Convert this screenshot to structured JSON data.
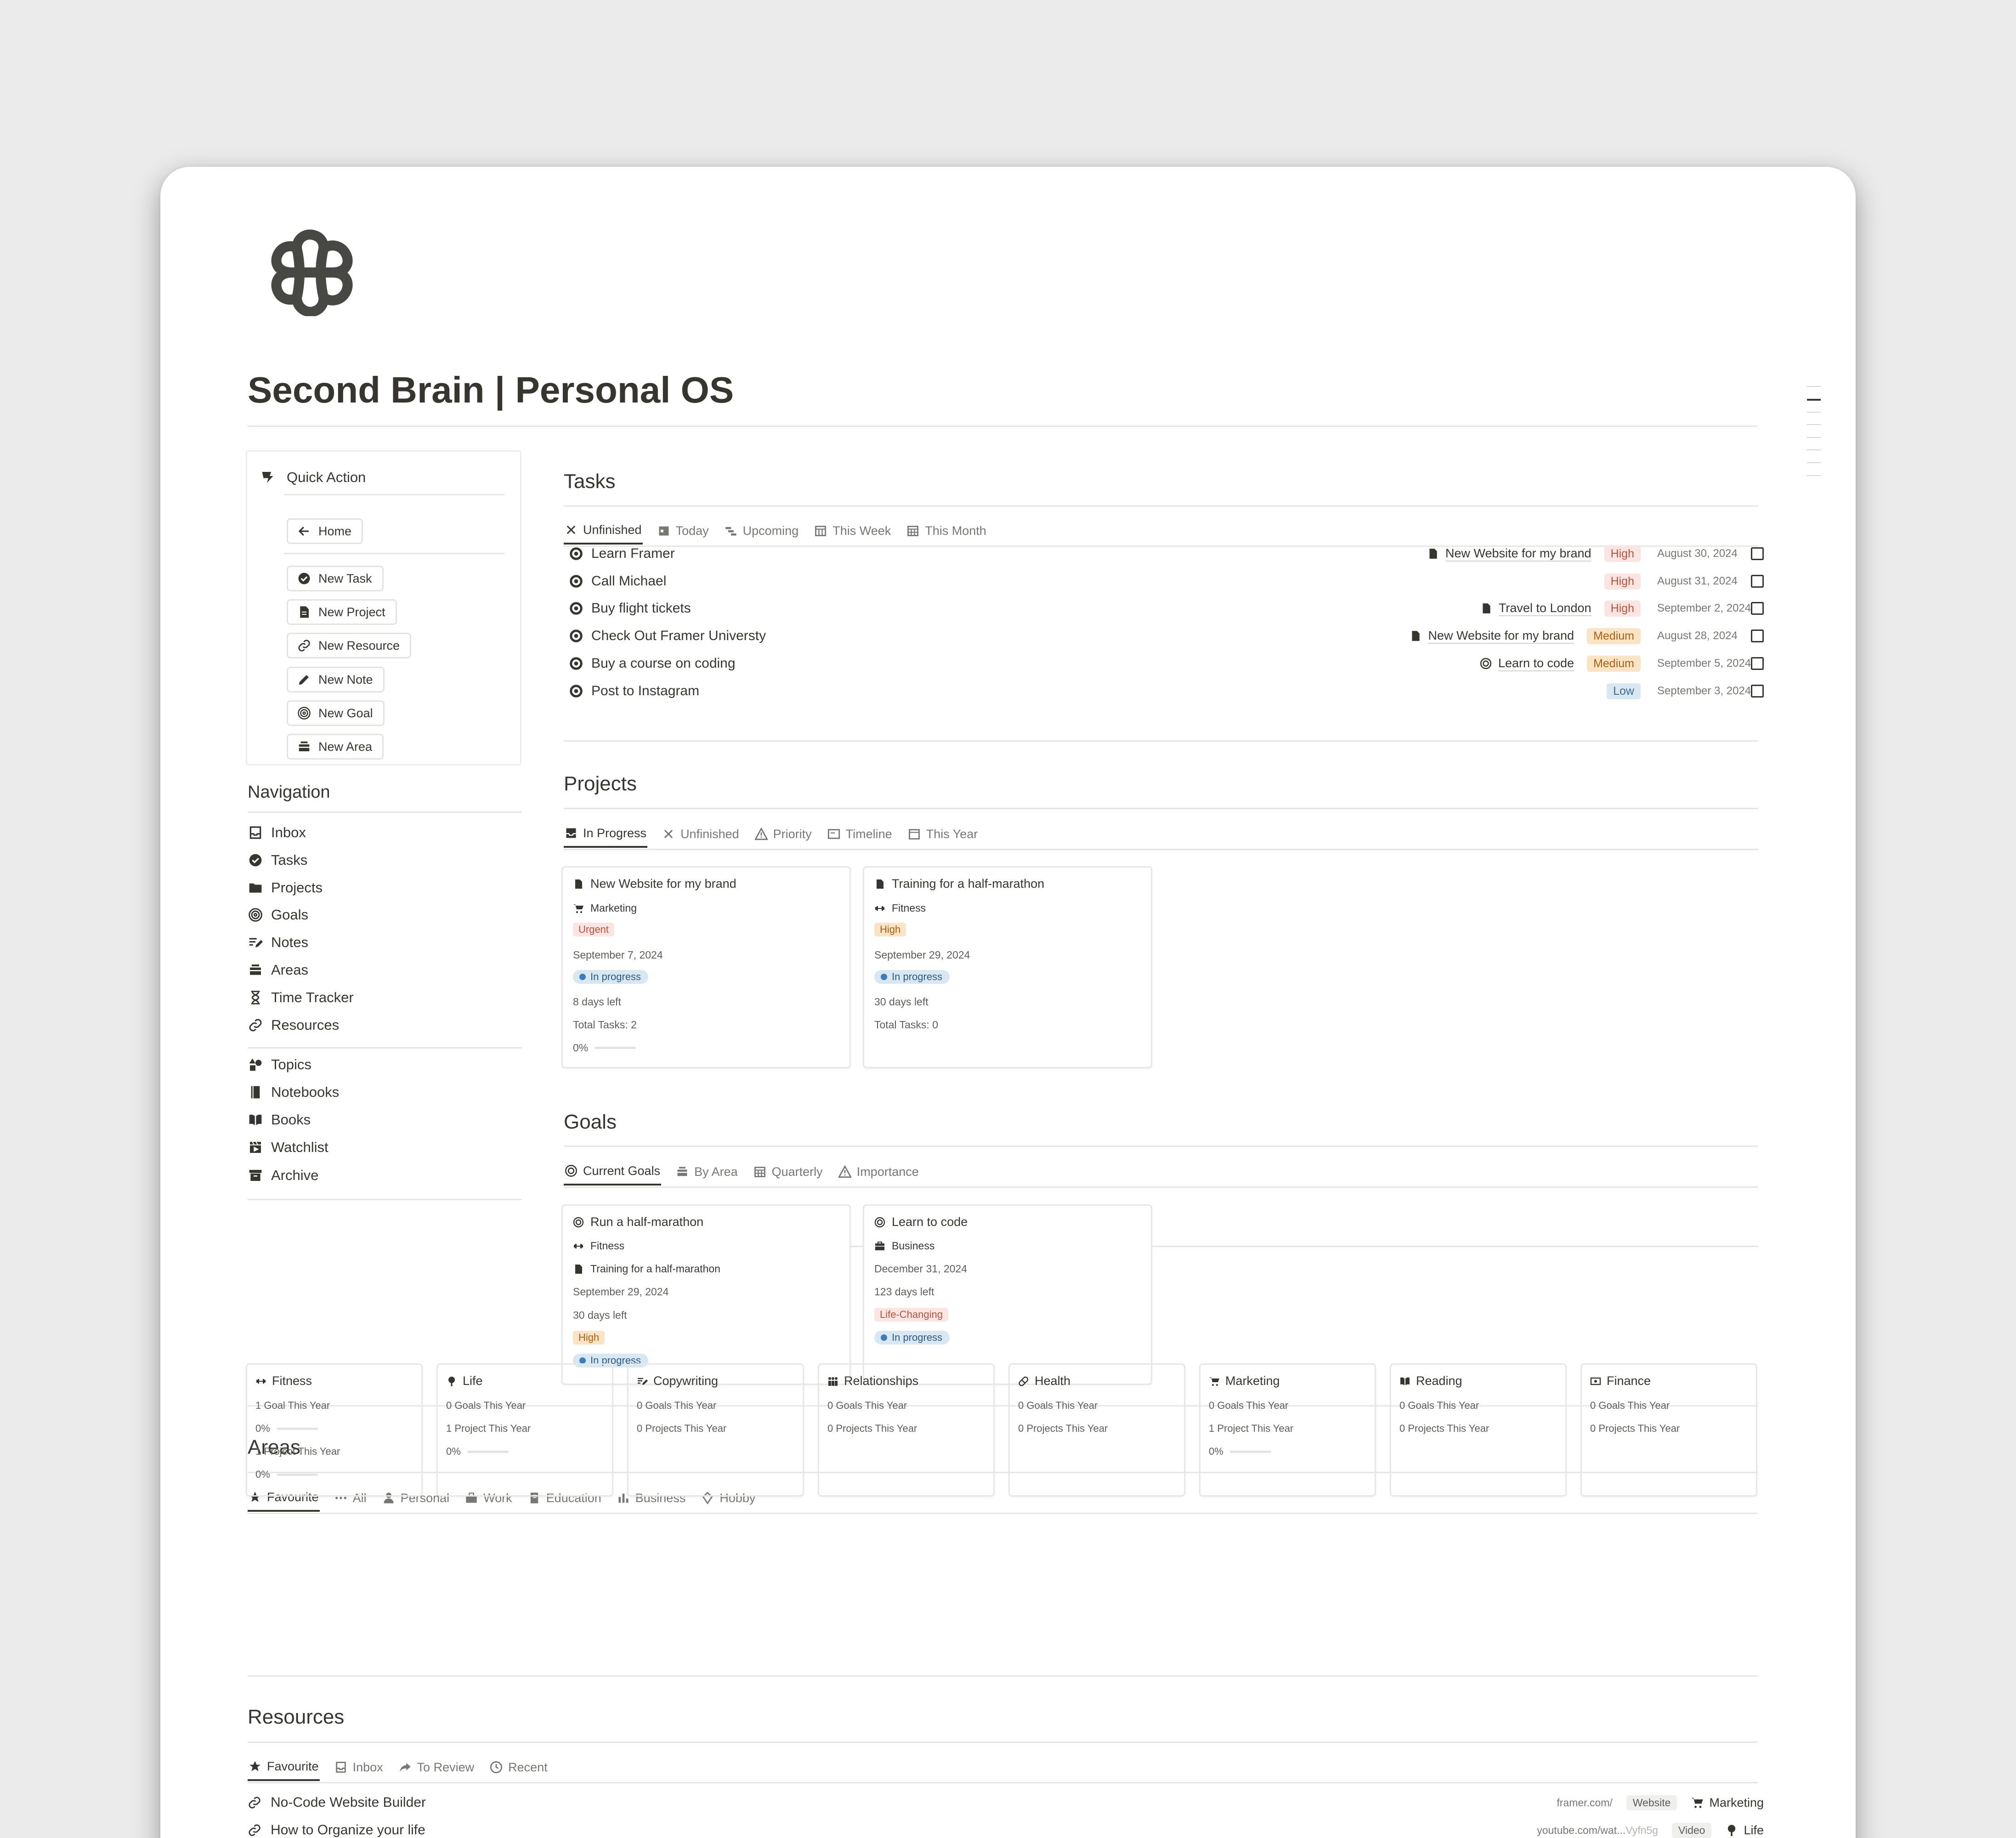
{
  "page": {
    "title": "Second Brain | Personal OS"
  },
  "quick_action": {
    "title": "Quick Action",
    "home": "Home",
    "buttons": [
      "New Task",
      "New Project",
      "New Resource",
      "New Note",
      "New Goal",
      "New Area"
    ]
  },
  "navigation": {
    "title": "Navigation",
    "items": [
      {
        "label": "Inbox",
        "icon": "inbox-icon"
      },
      {
        "label": "Tasks",
        "icon": "check-circle-icon"
      },
      {
        "label": "Projects",
        "icon": "folder-icon"
      },
      {
        "label": "Goals",
        "icon": "target-icon"
      },
      {
        "label": "Notes",
        "icon": "note-edit-icon"
      },
      {
        "label": "Areas",
        "icon": "stack-icon"
      },
      {
        "label": "Time Tracker",
        "icon": "hourglass-icon"
      },
      {
        "label": "Resources",
        "icon": "link-icon"
      }
    ],
    "items2": [
      {
        "label": "Topics",
        "icon": "shapes-icon"
      },
      {
        "label": "Notebooks",
        "icon": "notebook-icon"
      },
      {
        "label": "Books",
        "icon": "book-icon"
      },
      {
        "label": "Watchlist",
        "icon": "clapper-icon"
      },
      {
        "label": "Archive",
        "icon": "archive-icon"
      }
    ]
  },
  "tasks": {
    "title": "Tasks",
    "tabs": [
      "Unfinished",
      "Today",
      "Upcoming",
      "This Week",
      "This Month"
    ],
    "rows": [
      {
        "name": "Learn Framer",
        "project": "New Website for my brand",
        "priority": "High",
        "date": "August 30, 2024"
      },
      {
        "name": "Call Michael",
        "project": "",
        "priority": "High",
        "date": "August 31, 2024"
      },
      {
        "name": "Buy flight tickets",
        "project": "Travel to London",
        "priority": "High",
        "date": "September 2, 2024"
      },
      {
        "name": "Check Out Framer Universty",
        "project": "New Website for my brand",
        "priority": "Medium",
        "date": "August 28, 2024"
      },
      {
        "name": "Buy a course on coding",
        "project": "Learn to code",
        "priority": "Medium",
        "date": "September 5, 2024"
      },
      {
        "name": "Post to Instagram",
        "project": "",
        "priority": "Low",
        "date": "September 3, 2024"
      }
    ]
  },
  "projects": {
    "title": "Projects",
    "tabs": [
      "In Progress",
      "Unfinished",
      "Priority",
      "Timeline",
      "This Year"
    ],
    "cards": [
      {
        "name": "New Website for my brand",
        "area": "Marketing",
        "priority": "Urgent",
        "date": "September 7, 2024",
        "status": "In progress",
        "days_left": "8 days left",
        "total_tasks": "Total Tasks: 2",
        "progress": "0%"
      },
      {
        "name": "Training for a half-marathon",
        "area": "Fitness",
        "priority": "High",
        "date": "September 29, 2024",
        "status": "In progress",
        "days_left": "30 days left",
        "total_tasks": "Total Tasks: 0",
        "progress": ""
      }
    ]
  },
  "goals": {
    "title": "Goals",
    "tabs": [
      "Current Goals",
      "By Area",
      "Quarterly",
      "Importance"
    ],
    "cards": [
      {
        "name": "Run a half-marathon",
        "area": "Fitness",
        "project": "Training for a half-marathon",
        "date": "September 29, 2024",
        "days_left": "30 days left",
        "priority": "High",
        "status": "In progress"
      },
      {
        "name": "Learn to code",
        "area": "Business",
        "date": "December 31, 2024",
        "days_left": "123 days left",
        "priority": "Life-Changing",
        "status": "In progress"
      }
    ]
  },
  "areas": {
    "title": "Areas",
    "tabs": [
      "Favourite",
      "All",
      "Personal",
      "Work",
      "Education",
      "Business",
      "Hobby"
    ],
    "cards": [
      {
        "name": "Fitness",
        "goals": "1 Goal This Year",
        "goals_pct": "0%",
        "projects": "1 Project This Year",
        "projects_pct": "0%"
      },
      {
        "name": "Life",
        "goals": "0 Goals This Year",
        "projects": "1 Project This Year",
        "projects_pct": "0%"
      },
      {
        "name": "Copywriting",
        "goals": "0 Goals This Year",
        "projects": "0 Projects This Year"
      },
      {
        "name": "Relationships",
        "goals": "0 Goals This Year",
        "projects": "0 Projects This Year"
      },
      {
        "name": "Health",
        "goals": "0 Goals This Year",
        "projects": "0 Projects This Year"
      },
      {
        "name": "Marketing",
        "goals": "0 Goals This Year",
        "projects": "1 Project This Year",
        "projects_pct": "0%"
      },
      {
        "name": "Reading",
        "goals": "0 Goals This Year",
        "projects": "0 Projects This Year"
      },
      {
        "name": "Finance",
        "goals": "0 Goals This Year",
        "projects": "0 Projects This Year"
      }
    ]
  },
  "resources": {
    "title": "Resources",
    "tabs": [
      "Favourite",
      "Inbox",
      "To Review",
      "Recent"
    ],
    "rows": [
      {
        "name": "No-Code Website Builder",
        "url": "framer.com/",
        "url_dim": "",
        "kind": "Website",
        "area": "Marketing"
      },
      {
        "name": "How to Organize your life",
        "url": "youtube.com/wat...",
        "url_dim": "Vyfn5g",
        "kind": "Video",
        "area": "Life"
      }
    ]
  },
  "colors": {
    "text": "#37352f",
    "muted": "#787774",
    "high": "#fbe4e1",
    "medium": "#fbe3c6",
    "low": "#d9e7f2"
  }
}
